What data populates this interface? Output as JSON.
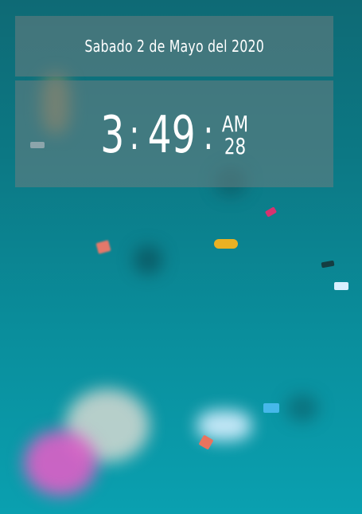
{
  "date": {
    "text": "Sabado 2 de Mayo del 2020"
  },
  "clock": {
    "hours": "3",
    "separator1": ":",
    "minutes": "49",
    "separator2": ":",
    "ampm": "AM",
    "seconds": "28"
  },
  "background": {
    "name": "blurred-confetti-teal"
  }
}
